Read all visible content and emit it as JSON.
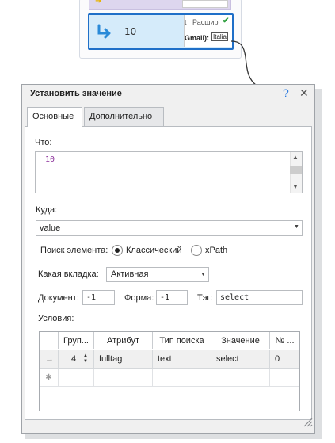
{
  "canvas_node": {
    "number": "10",
    "thumb_line1": "Расшир",
    "thumb_label": "Gmail):",
    "thumb_value": "Italia",
    "thumb_prefix": "t"
  },
  "dialog": {
    "title": "Установить значение",
    "help": "?",
    "close": "✕",
    "tabs": [
      "Основные",
      "Дополнительно"
    ],
    "what_label": "Что:",
    "what_value": "10",
    "where_label": "Куда:",
    "where_value": "value",
    "search_label": "Поиск элемента:",
    "radio_classic": "Классический",
    "radio_xpath": "xPath",
    "tab_label": "Какая вкладка:",
    "tab_value": "Активная",
    "doc_label": "Документ:",
    "doc_value": "-1",
    "form_label": "Форма:",
    "form_value": "-1",
    "tag_label": "Тэг:",
    "tag_value": "select",
    "conditions_label": "Условия:"
  },
  "grid": {
    "columns": [
      "Груп...",
      "Атрибут",
      "Тип поиска",
      "Значение",
      "№ ..."
    ],
    "rows": [
      {
        "marker": "→",
        "group": "4",
        "attribute": "fulltag",
        "search_type": "text",
        "value": "select",
        "number": "0"
      }
    ],
    "new_row_marker": "✱"
  },
  "colors": {
    "accent": "#1f6fc8",
    "node_fill": "#d5ebfa",
    "value_text": "#8a2e9a",
    "help_icon": "#2f7de1"
  }
}
